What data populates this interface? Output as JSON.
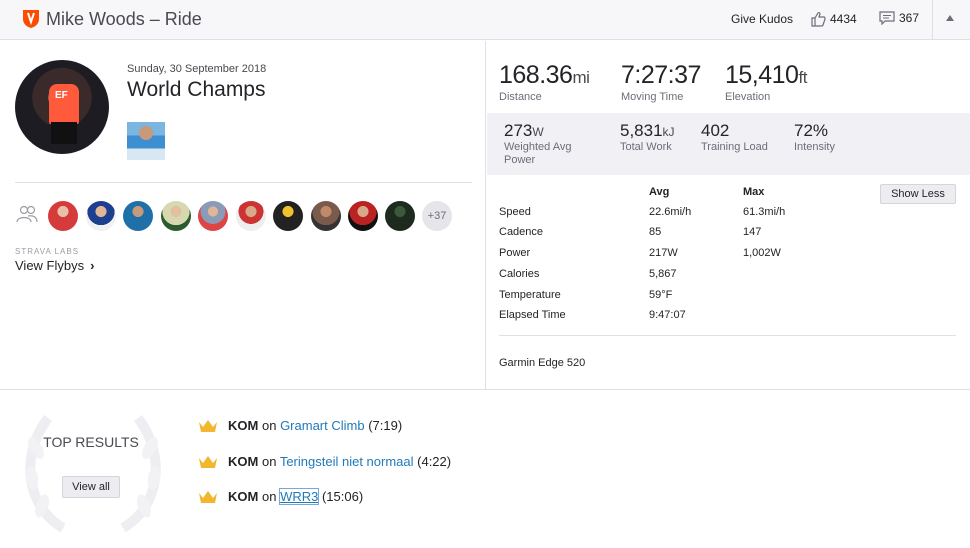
{
  "header": {
    "title": "Mike Woods – Ride",
    "give_kudos": "Give Kudos",
    "kudos_count": "4434",
    "comments_count": "367"
  },
  "activity": {
    "date": "Sunday, 30 September 2018",
    "name": "World Champs",
    "avatar_jersey_text": "EF",
    "more_athletes": "+37",
    "labs_label": "STRAVA LABS",
    "flybys_label": "View Flybys"
  },
  "stats": {
    "primary": [
      {
        "value": "168.36",
        "unit": "mi",
        "label": "Distance"
      },
      {
        "value": "7:27:37",
        "unit": "",
        "label": "Moving Time"
      },
      {
        "value": "15,410",
        "unit": "ft",
        "label": "Elevation"
      }
    ],
    "secondary": [
      {
        "value": "273",
        "unit": "W",
        "label": "Weighted Avg Power"
      },
      {
        "value": "5,831",
        "unit": "kJ",
        "label": "Total Work"
      },
      {
        "value": "402",
        "unit": "",
        "label": "Training Load"
      },
      {
        "value": "72%",
        "unit": "",
        "label": "Intensity"
      }
    ]
  },
  "details": {
    "avg_header": "Avg",
    "max_header": "Max",
    "show_less": "Show Less",
    "rows": [
      {
        "name": "Speed",
        "avg": "22.6mi/h",
        "max": "61.3mi/h"
      },
      {
        "name": "Cadence",
        "avg": "85",
        "max": "147"
      },
      {
        "name": "Power",
        "avg": "217W",
        "max": "1,002W"
      },
      {
        "name": "Calories",
        "avg": "5,867",
        "max": ""
      },
      {
        "name": "Temperature",
        "avg": "59°F",
        "max": ""
      },
      {
        "name": "Elapsed Time",
        "avg": "9:47:07",
        "max": ""
      }
    ],
    "device": "Garmin Edge 520"
  },
  "top_results": {
    "label": "TOP RESULTS",
    "view_all": "View all",
    "items": [
      {
        "badge": "KOM",
        "on": "on",
        "segment": "Gramart Climb",
        "time": "(7:19)"
      },
      {
        "badge": "KOM",
        "on": "on",
        "segment": "Teringsteil niet normaal",
        "time": "(4:22)"
      },
      {
        "badge": "KOM",
        "on": "on",
        "segment": "WRR3",
        "time": "(15:06)"
      }
    ]
  },
  "colors": {
    "brand": "#fc4c02",
    "link": "#1f7ab8",
    "crown": "#f2b630"
  },
  "icons": [
    "strava-shield-icon",
    "thumbs-up-icon",
    "comment-icon",
    "collapse-caret-icon",
    "group-icon",
    "chevron-right-icon",
    "crown-icon",
    "laurel-wreath-icon"
  ]
}
